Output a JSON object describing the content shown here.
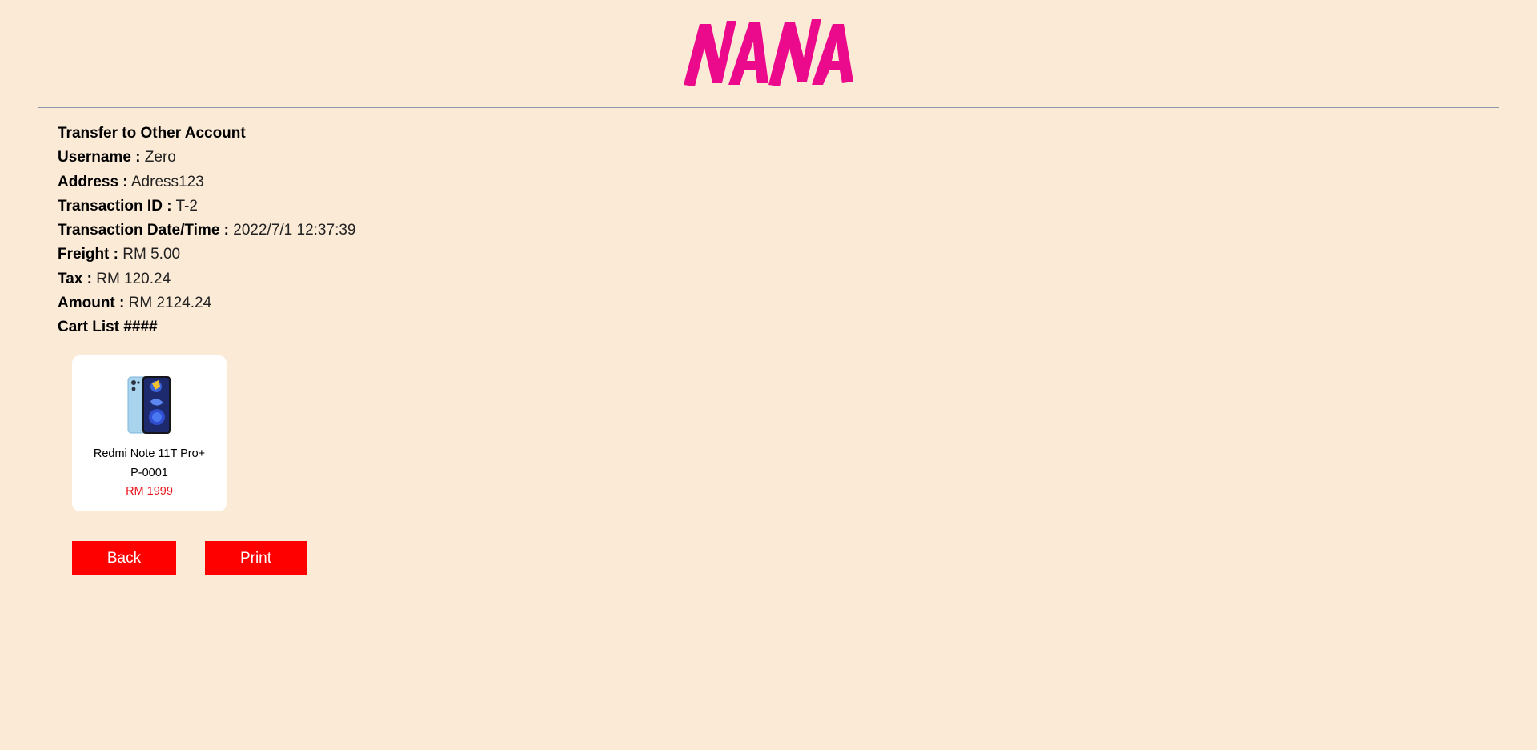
{
  "brand": {
    "logo_text": "NANA",
    "logo_color": "#EC0A8C"
  },
  "colors": {
    "background": "#FBEAD6",
    "button": "#FF0000",
    "price": "#E8141B"
  },
  "details": {
    "heading": "Transfer to Other Account",
    "rows": [
      {
        "label": "Username :",
        "value": "Zero"
      },
      {
        "label": "Address :",
        "value": "Adress123"
      },
      {
        "label": "Transaction ID :",
        "value": "T-2"
      },
      {
        "label": "Transaction Date/Time :",
        "value": "2022/7/1 12:37:39"
      },
      {
        "label": "Freight :",
        "value": "RM 5.00"
      },
      {
        "label": "Tax :",
        "value": "RM 120.24"
      },
      {
        "label": "Amount :",
        "value": "RM 2124.24"
      }
    ],
    "cart_heading": "Cart List ####"
  },
  "cart": {
    "items": [
      {
        "name": "Redmi Note 11T Pro+",
        "code": "P-0001",
        "price": "RM 1999",
        "icon": "smartphone-image"
      }
    ]
  },
  "actions": {
    "back_label": "Back",
    "print_label": "Print"
  }
}
